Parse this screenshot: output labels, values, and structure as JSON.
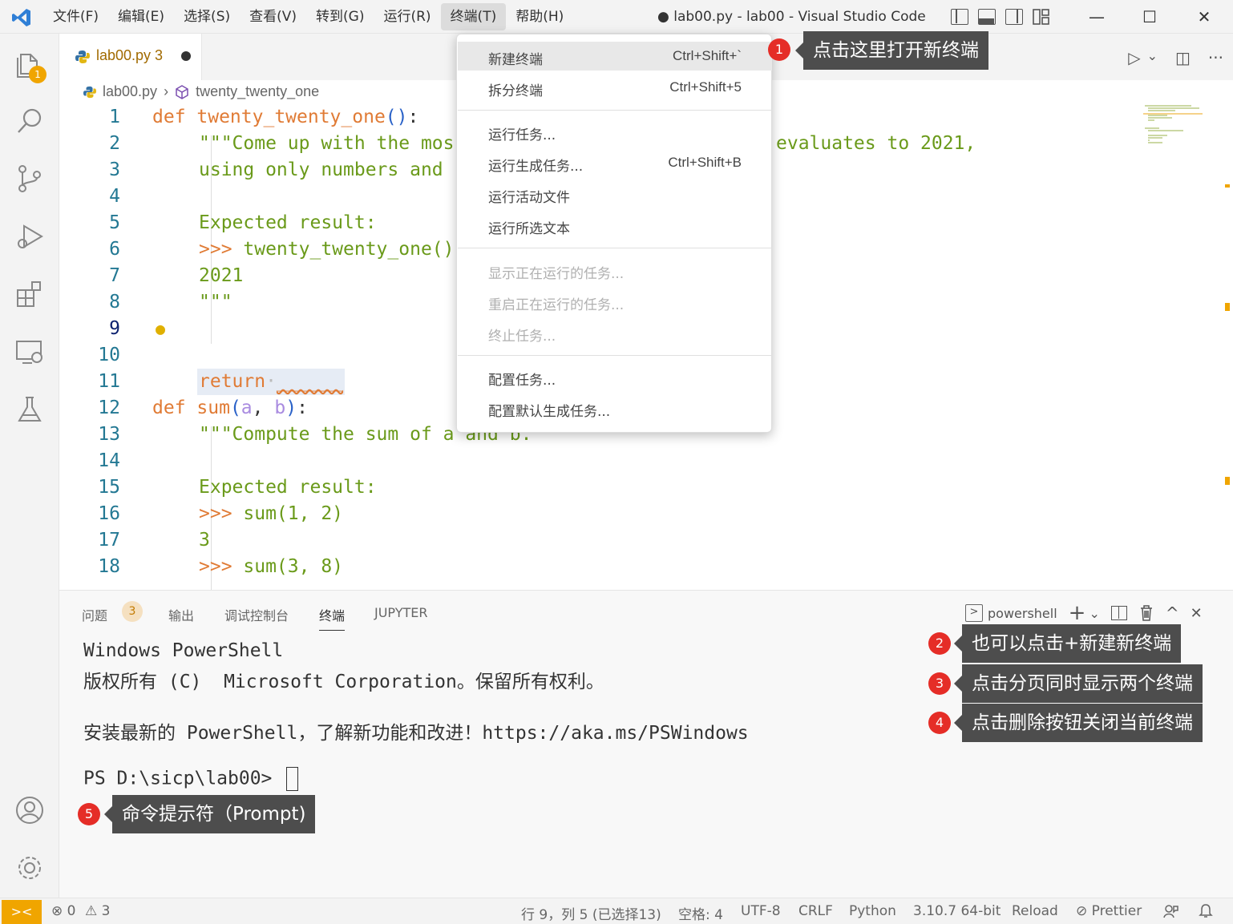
{
  "menubar": {
    "items": [
      "文件(F)",
      "编辑(E)",
      "选择(S)",
      "查看(V)",
      "转到(G)",
      "运行(R)",
      "终端(T)",
      "帮助(H)"
    ],
    "window_title": "● lab00.py - lab00 - Visual Studio Code",
    "min": "—",
    "max": "☐",
    "close": "✕"
  },
  "activitybar": {
    "explorer_badge": "1"
  },
  "editor": {
    "tab": {
      "name": "lab00.py 3"
    },
    "actions": {
      "run": "▷",
      "run_dropdown": "⌄",
      "split": "◫",
      "more": "···"
    },
    "breadcrumb": {
      "file": "lab00.py",
      "symbol": "twenty_twenty_one"
    },
    "lines": [
      {
        "n": "1"
      },
      {
        "n": "2"
      },
      {
        "n": "3"
      },
      {
        "n": "4"
      },
      {
        "n": "5"
      },
      {
        "n": "6"
      },
      {
        "n": "7"
      },
      {
        "n": "8"
      },
      {
        "n": "9"
      },
      {
        "n": "10"
      },
      {
        "n": "11"
      },
      {
        "n": "12"
      },
      {
        "n": "13"
      },
      {
        "n": "14"
      },
      {
        "n": "15"
      },
      {
        "n": "16"
      },
      {
        "n": "17"
      },
      {
        "n": "18"
      }
    ],
    "code": {
      "l1_def": "def ",
      "l1_fn": "twenty_twenty_one",
      "l1_par": "()",
      "l1_colon": ":",
      "l2": "\"\"\"Come up with the mos",
      "l2_right": "evaluates to 2021,",
      "l3": "using only numbers and",
      "l5": "Expected result:",
      "l6_prompt": ">>> ",
      "l6": "twenty_twenty_one()",
      "l7": "2021",
      "l8": "\"\"\"",
      "l9_kw": "return",
      "l9_dot": "·",
      "l9_blank": "______",
      "l12_def": "def ",
      "l12_fn": "sum",
      "l12_p1": "(",
      "l12_a": "a",
      "l12_comma": ", ",
      "l12_b": "b",
      "l12_p2": ")",
      "l12_colon": ":",
      "l13": "\"\"\"Compute the sum of a and b.",
      "l15": "Expected result:",
      "l16_prompt": ">>> ",
      "l16": "sum(1, 2)",
      "l17": "3",
      "l18_prompt": ">>> ",
      "l18": "sum(3, 8)"
    }
  },
  "terminal_menu": {
    "items": [
      {
        "label": "新建终端",
        "key": "Ctrl+Shift+`"
      },
      {
        "label": "拆分终端",
        "key": "Ctrl+Shift+5"
      },
      {
        "label": "运行任务..."
      },
      {
        "label": "运行生成任务...",
        "key": "Ctrl+Shift+B"
      },
      {
        "label": "运行活动文件"
      },
      {
        "label": "运行所选文本"
      },
      {
        "label": "显示正在运行的任务..."
      },
      {
        "label": "重启正在运行的任务..."
      },
      {
        "label": "终止任务..."
      },
      {
        "label": "配置任务..."
      },
      {
        "label": "配置默认生成任务..."
      }
    ]
  },
  "panel": {
    "tabs": [
      "问题",
      "输出",
      "调试控制台",
      "终端",
      "JUPYTER"
    ],
    "problems_count": "3",
    "shell": "powershell",
    "terminal": {
      "line1": "Windows PowerShell",
      "line2": "版权所有 (C)  Microsoft Corporation。保留所有权利。",
      "line3": "安装最新的 PowerShell，了解新功能和改进！https://aka.ms/PSWindows",
      "prompt": "PS D:\\sicp\\lab00> "
    }
  },
  "callouts": [
    {
      "num": "1",
      "text": "点击这里打开新终端"
    },
    {
      "num": "2",
      "text": "也可以点击+新建新终端"
    },
    {
      "num": "3",
      "text": "点击分页同时显示两个终端"
    },
    {
      "num": "4",
      "text": "点击删除按钮关闭当前终端"
    },
    {
      "num": "5",
      "text": "命令提示符（Prompt)"
    }
  ],
  "statusbar": {
    "remote": "><",
    "errors": "⊗ 0",
    "warnings": "⚠ 3",
    "position": "行 9，列 5 (已选择13)",
    "spaces": "空格: 4",
    "encoding": "UTF-8",
    "eol": "CRLF",
    "language": "Python",
    "interpreter": "3.10.7 64-bit",
    "reload": "Reload",
    "prettier": "⊘ Prettier"
  }
}
